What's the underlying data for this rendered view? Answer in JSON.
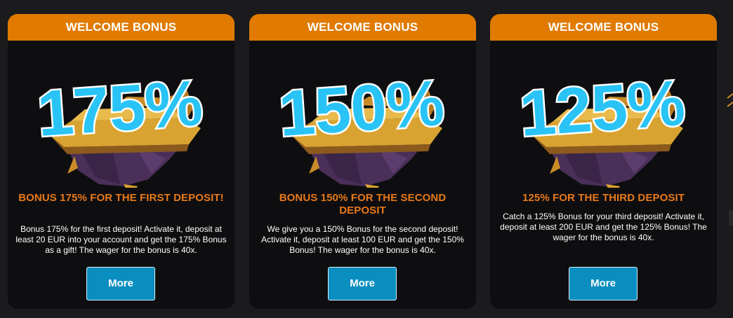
{
  "cards": [
    {
      "header": "WELCOME BONUS",
      "percent": "175%",
      "title": "BONUS 175% FOR THE FIRST DEPOSIT!",
      "description": "Bonus 175% for the first deposit! Activate it, deposit at least 20 EUR into your account and get the 175% Bonus as a gift! The wager for the bonus is 40x.",
      "button": "More"
    },
    {
      "header": "WELCOME BONUS",
      "percent": "150%",
      "title": "BONUS 150% FOR THE SECOND DEPOSIT",
      "description": "We give you a 150% Bonus for the second deposit! Activate it, deposit at least 100 EUR and get the 150% Bonus! The wager for the bonus is 40x.",
      "button": "More"
    },
    {
      "header": "WELCOME BONUS",
      "percent": "125%",
      "title": "125% FOR THE THIRD DEPOSIT",
      "description": "Catch a 125% Bonus for your third deposit! Activate it, deposit at least 200 EUR and get the 125% Bonus! The wager for the bonus is 40x.",
      "button": "More"
    }
  ],
  "colors": {
    "header_bg": "#e07a00",
    "title": "#e8791a",
    "button_bg": "#0a8ec0",
    "percent_text": "#29c4f5",
    "island_top": "#d9a331",
    "island_rock": "#4a2f59"
  },
  "icons": {
    "island": "floating-island-illustration"
  }
}
